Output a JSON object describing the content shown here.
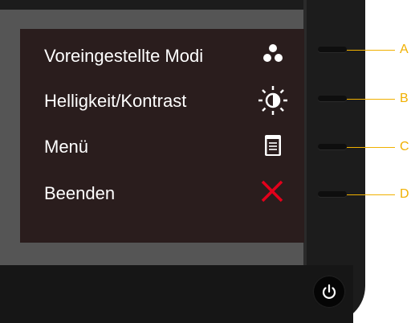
{
  "osd_menu": {
    "items": [
      {
        "label": "Voreingestellte Modi",
        "icon": "preset-modes-icon"
      },
      {
        "label": "Helligkeit/Kontrast",
        "icon": "brightness-contrast-icon"
      },
      {
        "label": "Menü",
        "icon": "menu-icon"
      },
      {
        "label": "Beenden",
        "icon": "exit-x-icon"
      }
    ]
  },
  "hardware_buttons": {
    "callouts": [
      "A",
      "B",
      "C",
      "D"
    ]
  },
  "power": {
    "icon": "power-icon"
  },
  "colors": {
    "callout": "#f0b000",
    "exit_icon": "#e3001b",
    "osd_background": "#2a1d1d",
    "osd_text": "#ffffff"
  }
}
